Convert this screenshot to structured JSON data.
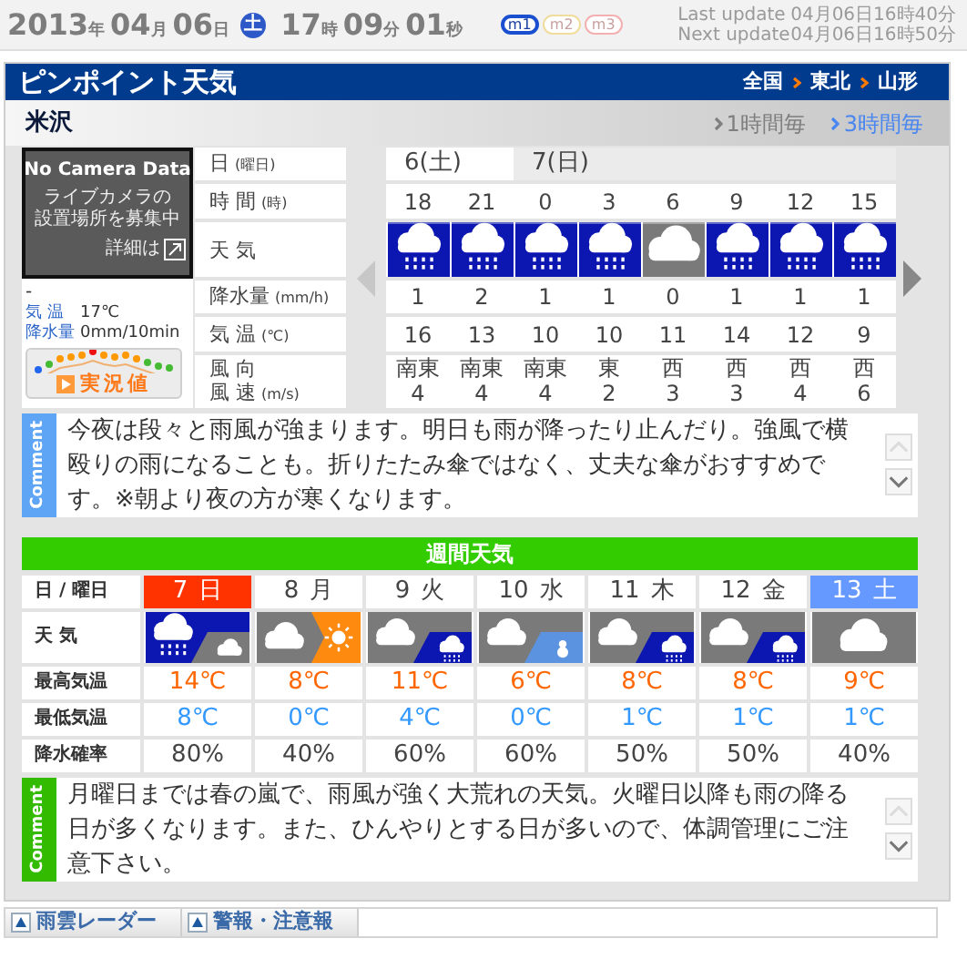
{
  "header": {
    "date": [
      {
        "value": "2013",
        "unit": "年"
      },
      {
        "value": "04",
        "unit": "月"
      },
      {
        "value": "06",
        "unit": "日"
      }
    ],
    "weekday": "土",
    "time": [
      {
        "value": "17",
        "unit": "時"
      },
      {
        "value": "09",
        "unit": "分"
      },
      {
        "value": "01",
        "unit": "秒"
      }
    ],
    "modes": [
      {
        "label": "m1",
        "selected": true,
        "color": "#1a4fd0"
      },
      {
        "label": "m2",
        "selected": false,
        "color": "#f0dc9c"
      },
      {
        "label": "m3",
        "selected": false,
        "color": "#f4b0b0"
      }
    ],
    "updates": [
      {
        "label": "Last update",
        "value": "04月06日16時40分"
      },
      {
        "label": "Next update",
        "value": "04月06日16時50分"
      }
    ]
  },
  "title": "ピンポイント天気",
  "breadcrumbs": [
    "全国",
    "東北",
    "山形"
  ],
  "location": "米沢",
  "intervals": [
    {
      "label": "1時間毎",
      "selected": false
    },
    {
      "label": "3時間毎",
      "selected": true
    }
  ],
  "camera": {
    "title": "No Camera Data",
    "message_lines": [
      "ライブカメラの",
      "設置場所を募集中"
    ],
    "link": "詳細は"
  },
  "observation": {
    "value": "-",
    "rows": [
      {
        "label": "気 温",
        "value": "17℃"
      },
      {
        "label": "降水量",
        "value": "0mm/10min"
      }
    ],
    "button": "実況値"
  },
  "hourly": {
    "row_labels": [
      {
        "lines": [
          {
            "text": "日",
            "unit": "(曜日)"
          }
        ]
      },
      {
        "lines": [
          {
            "text": "時 間",
            "unit": "(時)"
          }
        ]
      },
      {
        "lines": [
          {
            "text": "天 気"
          }
        ]
      },
      {
        "lines": [
          {
            "text": "降水量",
            "unit": "(mm/h)"
          }
        ]
      },
      {
        "lines": [
          {
            "text": "気 温",
            "unit": "(℃)"
          }
        ]
      },
      {
        "lines": [
          {
            "text": "風 向"
          },
          {
            "text": "風 速",
            "unit": "(m/s)"
          }
        ]
      }
    ],
    "prev": {
      "disabled": true
    },
    "next": {
      "disabled": false
    },
    "days": [
      {
        "label": "6(土)",
        "current": true,
        "hours": [
          {
            "hour": "18",
            "kind": "rain",
            "precip": "1",
            "temp": "16",
            "wind_dir": "南東",
            "wind_speed": "4"
          },
          {
            "hour": "21",
            "kind": "rain",
            "precip": "2",
            "temp": "13",
            "wind_dir": "南東",
            "wind_speed": "4"
          }
        ]
      },
      {
        "label": "7(日)",
        "current": false,
        "hours": [
          {
            "hour": "0",
            "kind": "rain",
            "precip": "1",
            "temp": "10",
            "wind_dir": "南東",
            "wind_speed": "4"
          },
          {
            "hour": "3",
            "kind": "rain",
            "precip": "1",
            "temp": "10",
            "wind_dir": "東",
            "wind_speed": "2"
          },
          {
            "hour": "6",
            "kind": "cloudy",
            "precip": "0",
            "temp": "11",
            "wind_dir": "西",
            "wind_speed": "3"
          },
          {
            "hour": "9",
            "kind": "rain",
            "precip": "1",
            "temp": "14",
            "wind_dir": "西",
            "wind_speed": "3"
          },
          {
            "hour": "12",
            "kind": "rain",
            "precip": "1",
            "temp": "12",
            "wind_dir": "西",
            "wind_speed": "4"
          },
          {
            "hour": "15",
            "kind": "rain",
            "precip": "1",
            "temp": "9",
            "wind_dir": "西",
            "wind_speed": "6"
          }
        ]
      }
    ]
  },
  "comment": {
    "tab": "Comment",
    "text": "今夜は段々と雨風が強まります。明日も雨が降ったり止んだり。強風で横殴りの雨になることも。折りたたみ傘ではなく、丈夫な傘がおすすめです。※朝より夜の方が寒くなります。",
    "scroll_up": {
      "disabled": true
    },
    "scroll_down": {
      "disabled": false
    }
  },
  "weekly": {
    "title": "週間天気",
    "header_label": "日 / 曜日",
    "row_labels": [
      "天 気",
      "最高気温",
      "最低気温",
      "降水確率"
    ],
    "days": [
      {
        "date": "7",
        "weekday": "日",
        "kind": "sunday",
        "weather": {
          "kind": "sometimes",
          "parts": [
            {
              "kind": "rain"
            },
            {
              "kind": "cloudy"
            }
          ]
        },
        "max": "14℃",
        "min": "8℃",
        "pop": "80%"
      },
      {
        "date": "8",
        "weekday": "月",
        "kind": "weekday",
        "weather": {
          "kind": "later",
          "parts": [
            {
              "kind": "cloudy"
            },
            {
              "kind": "sunny"
            }
          ]
        },
        "max": "8℃",
        "min": "0℃",
        "pop": "40%"
      },
      {
        "date": "9",
        "weekday": "火",
        "kind": "weekday",
        "weather": {
          "kind": "sometimes",
          "parts": [
            {
              "kind": "cloudy"
            },
            {
              "kind": "rain"
            }
          ]
        },
        "max": "11℃",
        "min": "4℃",
        "pop": "60%"
      },
      {
        "date": "10",
        "weekday": "水",
        "kind": "weekday",
        "weather": {
          "kind": "sometimes",
          "parts": [
            {
              "kind": "cloudy"
            },
            {
              "kind": "snow"
            }
          ]
        },
        "max": "6℃",
        "min": "0℃",
        "pop": "60%"
      },
      {
        "date": "11",
        "weekday": "木",
        "kind": "weekday",
        "weather": {
          "kind": "sometimes",
          "parts": [
            {
              "kind": "cloudy"
            },
            {
              "kind": "rain"
            }
          ]
        },
        "max": "8℃",
        "min": "1℃",
        "pop": "50%"
      },
      {
        "date": "12",
        "weekday": "金",
        "kind": "weekday",
        "weather": {
          "kind": "sometimes",
          "parts": [
            {
              "kind": "cloudy"
            },
            {
              "kind": "rain"
            }
          ]
        },
        "max": "8℃",
        "min": "1℃",
        "pop": "50%"
      },
      {
        "date": "13",
        "weekday": "土",
        "kind": "saturday",
        "weather": {
          "kind": "single",
          "parts": [
            {
              "kind": "cloudy"
            }
          ]
        },
        "max": "9℃",
        "min": "1℃",
        "pop": "40%"
      }
    ]
  },
  "weekly_comment": {
    "tab": "Comment",
    "text": "月曜日までは春の嵐で、雨風が強く大荒れの天気。火曜日以降も雨の降る日が多くなります。また、ひんやりとする日が多いので、体調管理にご注意下さい。",
    "scroll_up": {
      "disabled": true
    },
    "scroll_down": {
      "disabled": false
    }
  },
  "footer_tabs": [
    "雨雲レーダー",
    "警報・注意報"
  ]
}
